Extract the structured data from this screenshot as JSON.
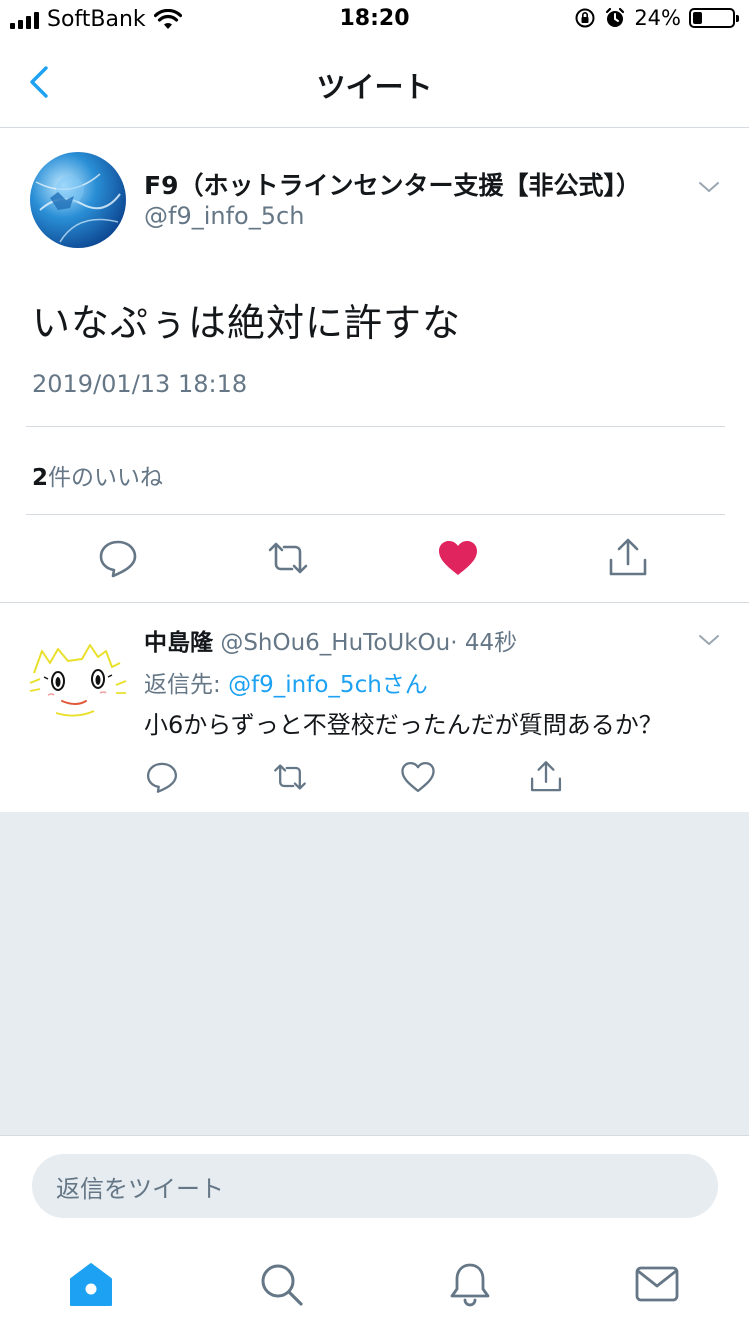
{
  "status_bar": {
    "carrier": "SoftBank",
    "time": "18:20",
    "battery": "24%",
    "icons": [
      "signal-icon",
      "wifi-icon",
      "orientation-lock-icon",
      "alarm-icon",
      "battery-icon"
    ]
  },
  "nav": {
    "title": "ツイート",
    "back_icon": "chevron-left-icon"
  },
  "main_tweet": {
    "author_name": "F9（ホットラインセンター支援【非公式】）",
    "author_handle": "@f9_info_5ch",
    "text": "いなぷぅは絶対に許すな",
    "timestamp": "2019/01/13 18:18",
    "likes_count": "2",
    "likes_label": "件のいいね",
    "liked": true,
    "like_color": "#e0245e"
  },
  "reply_tweet": {
    "author_name": "中島隆",
    "author_handle": "@ShOu6_HuToUkOu",
    "time": "· 44秒",
    "reply_to_prefix": "返信先: ",
    "reply_to_handle": "@f9_info_5chさん",
    "text": "小6からずっと不登校だったんだが質問あるか？"
  },
  "composer": {
    "placeholder": "返信をツイート"
  },
  "tabbar": {
    "tabs": [
      "home-icon",
      "search-icon",
      "notifications-icon",
      "messages-icon"
    ]
  },
  "colors": {
    "accent": "#1da1f2",
    "secondary_text": "#657786",
    "background_gray": "#e6ecf0"
  }
}
